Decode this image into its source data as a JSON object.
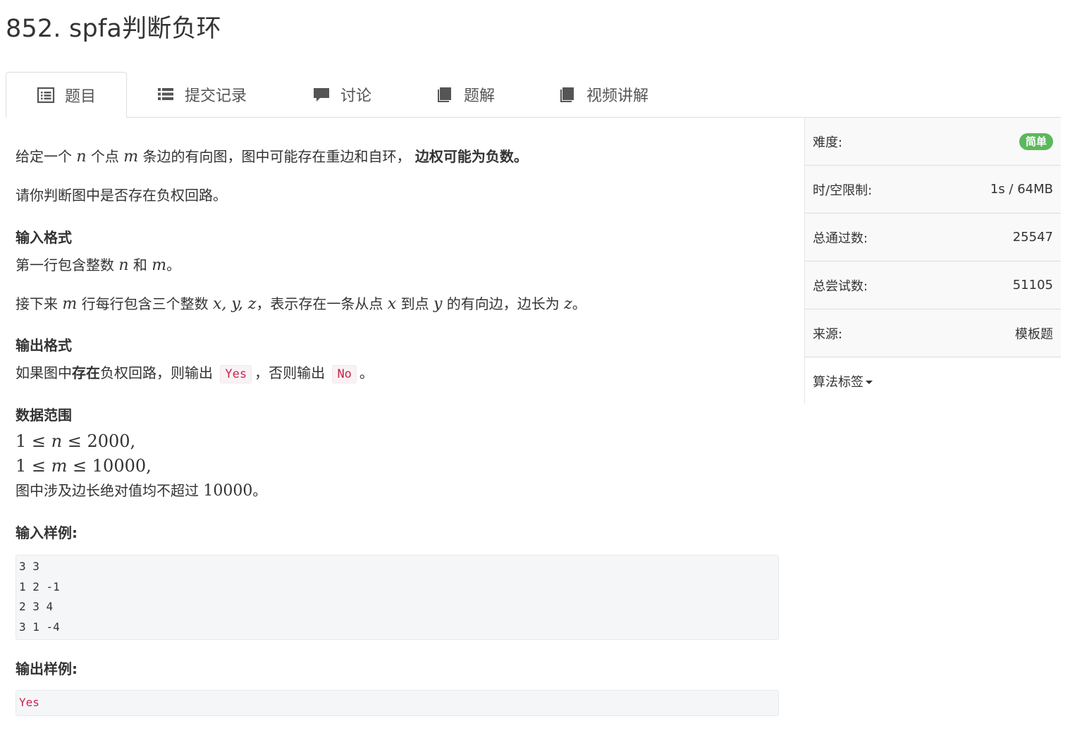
{
  "problem": {
    "title": "852. spfa判断负环"
  },
  "tabs": [
    {
      "label": "题目",
      "icon": "list-alt-icon",
      "active": true
    },
    {
      "label": "提交记录",
      "icon": "list-icon",
      "active": false
    },
    {
      "label": "讨论",
      "icon": "comment-icon",
      "active": false
    },
    {
      "label": "题解",
      "icon": "book-icon",
      "active": false
    },
    {
      "label": "视频讲解",
      "icon": "book-icon",
      "active": false
    }
  ],
  "statement": {
    "p1_a": "给定一个",
    "p1_var_n": "n",
    "p1_b": "个点",
    "p1_var_m": "m",
    "p1_c": "条边的有向图，图中可能存在重边和自环，",
    "p1_bold": "边权可能为负数",
    "p1_end": "。",
    "p2": "请你判断图中是否存在负权回路。",
    "input_heading": "输入格式",
    "in1_a": "第一行包含整数",
    "in1_var_n": "n",
    "in1_b": "和",
    "in1_var_m": "m",
    "in1_end": "。",
    "in2_a": "接下来",
    "in2_var_m": "m",
    "in2_b": "行每行包含三个整数",
    "in2_vars": "x, y, z",
    "in2_c": "，表示存在一条从点",
    "in2_var_x": "x",
    "in2_d": "到点",
    "in2_var_y": "y",
    "in2_e": "的有向边，边长为",
    "in2_var_z": "z",
    "in2_end": "。",
    "output_heading": "输出格式",
    "out_a": "如果图中",
    "out_bold": "存在",
    "out_b": "负权回路，则输出",
    "out_code_yes": "Yes",
    "out_c": "，否则输出",
    "out_code_no": "No",
    "out_end": "。",
    "range_heading": "数据范围",
    "range1_a": "1 ≤ ",
    "range1_var": "n",
    "range1_b": " ≤ 2000,",
    "range2_a": "1 ≤ ",
    "range2_var": "m",
    "range2_b": " ≤ 10000,",
    "range3_a": "图中涉及边长绝对值均不超过",
    "range3_num": "10000",
    "range3_end": "。",
    "sample_in_heading": "输入样例:",
    "sample_in_lines": [
      "3 3",
      "1 2 -1",
      "2 3 4",
      "3 1 -4"
    ],
    "sample_out_heading": "输出样例:",
    "sample_out_lines": [
      "Yes"
    ]
  },
  "sidebar": {
    "difficulty_label": "难度:",
    "difficulty_value": "简单",
    "limit_label": "时/空限制:",
    "limit_value": "1s / 64MB",
    "passed_label": "总通过数:",
    "passed_value": "25547",
    "tried_label": "总尝试数:",
    "tried_value": "51105",
    "source_label": "来源:",
    "source_value": "模板题",
    "tags_label": "算法标签",
    "difficulty_color": "#5cb85c"
  }
}
